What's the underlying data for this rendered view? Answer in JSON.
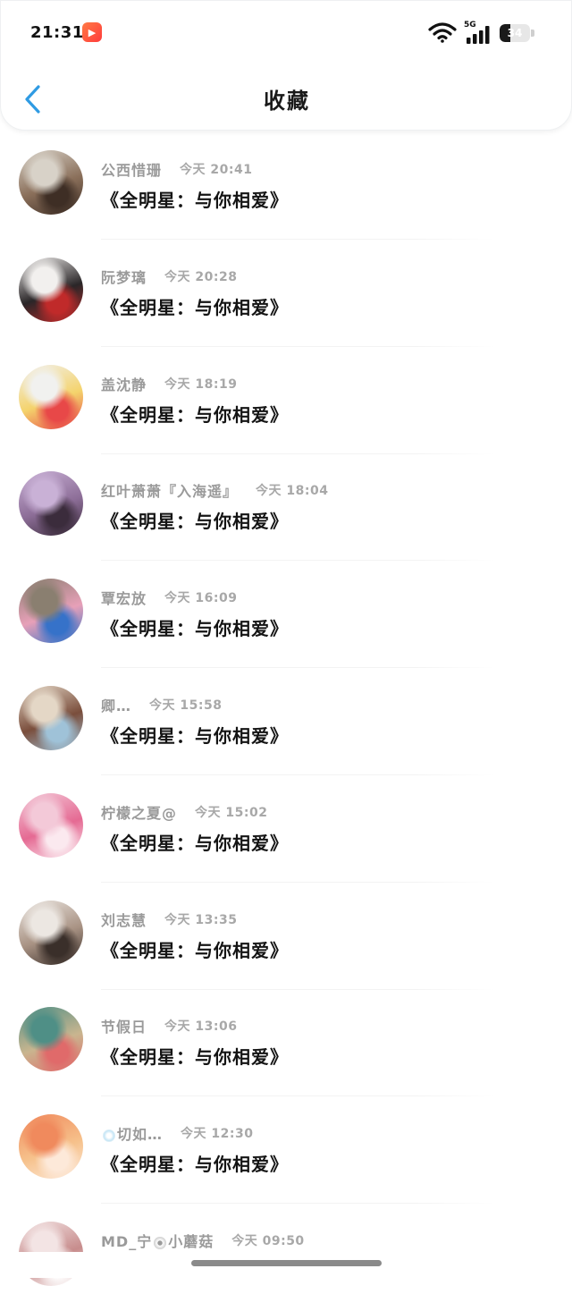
{
  "status_bar": {
    "time": "21:31",
    "app_badge_icon": "video-app-icon",
    "network_type": "5G",
    "battery_level": "34",
    "battery_fraction": 0.34
  },
  "header": {
    "title": "收藏",
    "back_icon": "chevron-left-icon",
    "accent_color": "#2f9be3"
  },
  "items": [
    {
      "name": "公西惜珊",
      "time": "今天 20:41",
      "title": "《全明星：与你相爱》",
      "avatar_colors": [
        "#d8d2c8",
        "#8a6f5a",
        "#3e2e25"
      ]
    },
    {
      "name": "阮梦璃",
      "time": "今天 20:28",
      "title": "《全明星：与你相爱》",
      "avatar_colors": [
        "#f2f0ee",
        "#2a2628",
        "#c02a2a"
      ]
    },
    {
      "name": "盖沈静",
      "time": "今天 18:19",
      "title": "《全明星：与你相爱》",
      "avatar_colors": [
        "#f1f1ef",
        "#f4d36c",
        "#e84848"
      ]
    },
    {
      "name": "红叶萧萧『入海遥』",
      "time": "今天 18:04",
      "title": "《全明星：与你相爱》",
      "avatar_colors": [
        "#c9b1d6",
        "#8d6e98",
        "#3b2c3c"
      ]
    },
    {
      "name": "覃宏放",
      "time": "今天 16:09",
      "title": "《全明星：与你相爱》",
      "avatar_colors": [
        "#8a7f70",
        "#e7a0b8",
        "#3672c9"
      ]
    },
    {
      "name": "卿…",
      "time": "今天 15:58",
      "title": "《全明星：与你相爱》",
      "avatar_colors": [
        "#e4d7c6",
        "#7a4e3c",
        "#9fc2d8"
      ]
    },
    {
      "name": "柠檬之夏@",
      "time": "今天 15:02",
      "title": "《全明星：与你相爱》",
      "avatar_colors": [
        "#f3c9d8",
        "#e56a93",
        "#fbe9ef"
      ]
    },
    {
      "name": "刘志慧",
      "time": "今天 13:35",
      "title": "《全明星：与你相爱》",
      "avatar_colors": [
        "#ece7e2",
        "#a89283",
        "#3a2f2a"
      ]
    },
    {
      "name": "节假日",
      "time": "今天 13:06",
      "title": "《全明星：与你相爱》",
      "avatar_colors": [
        "#4f8f86",
        "#c9b58f",
        "#e06a6a"
      ]
    },
    {
      "name": "切如…",
      "time": "今天 12:30",
      "title": "《全明星：与你相爱》",
      "avatar_colors": [
        "#f08a5d",
        "#f6c18b",
        "#fde9d9"
      ],
      "name_prefix_icon": "sparkle-icon"
    },
    {
      "name": "MD_宁",
      "name_suffix": "小蘑菇",
      "time": "今天 09:50",
      "title": "",
      "avatar_colors": [
        "#f3e4e4",
        "#c78c8c",
        "#ffffff"
      ],
      "name_mid_icon": "flower-icon"
    }
  ]
}
